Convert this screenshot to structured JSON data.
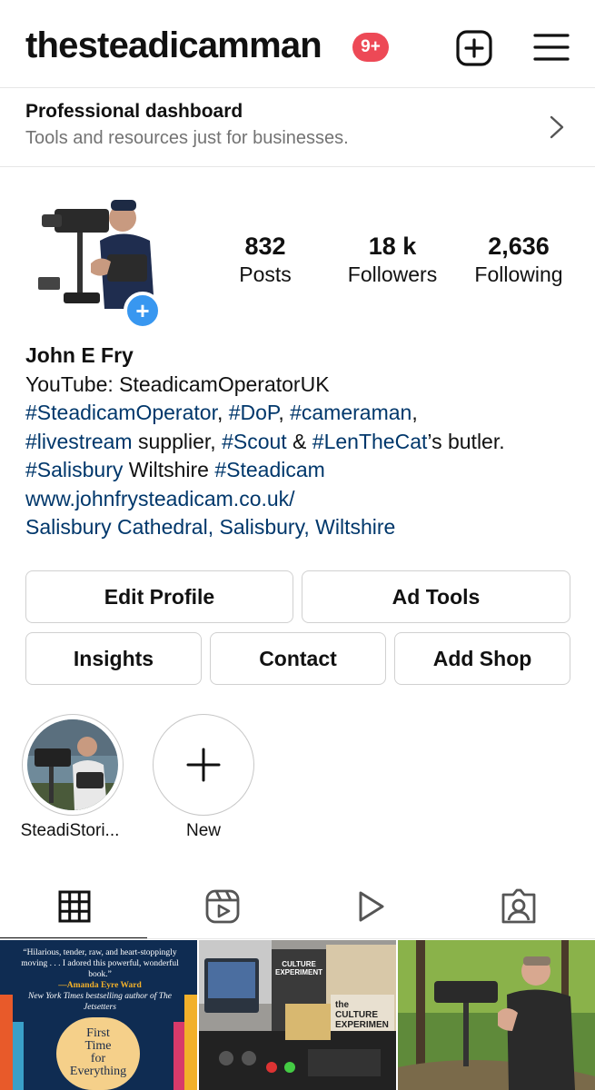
{
  "header": {
    "username": "thesteadicamman",
    "notifications": "9+",
    "icons": [
      "new-post-icon",
      "menu-icon"
    ]
  },
  "dashboard": {
    "title": "Professional dashboard",
    "subtitle": "Tools and resources just for businesses."
  },
  "profile": {
    "stats": [
      {
        "value": "832",
        "label": "Posts"
      },
      {
        "value": "18 k",
        "label": "Followers"
      },
      {
        "value": "2,636",
        "label": "Following"
      }
    ],
    "name": "John E Fry",
    "bio": {
      "line1": "YouTube: SteadicamOperatorUK",
      "line2": {
        "t1": "#SteadicamOperator",
        "p1": ", ",
        "t2": "#DoP",
        "p2": ", ",
        "t3": "#cameraman",
        "p3": ","
      },
      "line3": {
        "t1": "#livestream",
        "p1": " supplier, ",
        "t2": "#Scout",
        "p2": " & ",
        "t3": "#LenTheCat",
        "p3": "’s butler."
      },
      "line4": {
        "t1": "#Salisbury",
        "p1": " Wiltshire ",
        "t2": "#Steadicam"
      },
      "website": "www.johnfrysteadicam.co.uk/",
      "location": "Salisbury Cathedral, Salisbury, Wiltshire"
    }
  },
  "buttons": {
    "edit_profile": "Edit Profile",
    "ad_tools": "Ad Tools",
    "insights": "Insights",
    "contact": "Contact",
    "add_shop": "Add Shop"
  },
  "highlights": [
    {
      "label": "SteadiStori..."
    },
    {
      "label": "New"
    }
  ],
  "tabs": [
    "grid-icon",
    "reels-icon",
    "video-icon",
    "tagged-icon"
  ],
  "grid": {
    "tile1": {
      "quote": "“Hilarious, tender, raw, and heart-stoppingly moving . . . I adored this powerful, wonderful book.”",
      "author": "—Amanda Eyre Ward",
      "credit": "New York Times bestselling author of The Jetsetters",
      "cover_l1": "First",
      "cover_l2": "Time",
      "cover_l3": "for",
      "cover_l4": "Everything"
    },
    "tile2": {
      "sign1": "CULTURE EXPERIMENT",
      "sign2": "the CULTURE EXPERIMEN"
    }
  },
  "colors": {
    "hashtag": "#00376b",
    "badge": "#ed4956",
    "accent": "#3897f0"
  }
}
